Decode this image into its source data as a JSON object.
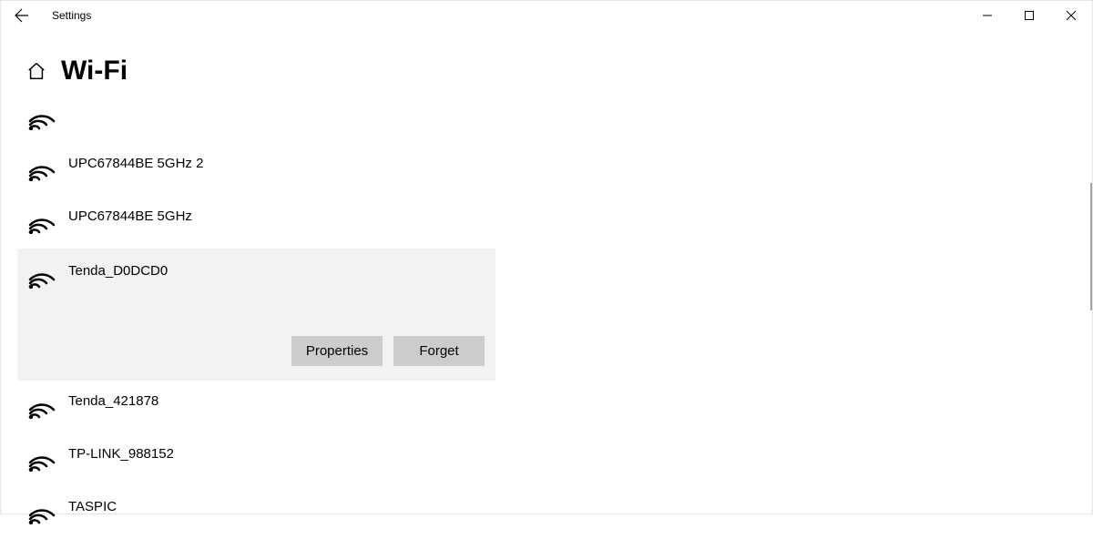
{
  "window": {
    "title": "Settings"
  },
  "page": {
    "title": "Wi-Fi"
  },
  "networks": [
    {
      "name": ""
    },
    {
      "name": "UPC67844BE 5GHz 2"
    },
    {
      "name": "UPC67844BE 5GHz"
    },
    {
      "name": "Tenda_D0DCD0",
      "selected": true
    },
    {
      "name": "Tenda_421878"
    },
    {
      "name": "TP-LINK_988152"
    },
    {
      "name": "TASPIC"
    }
  ],
  "actions": {
    "properties": "Properties",
    "forget": "Forget"
  }
}
